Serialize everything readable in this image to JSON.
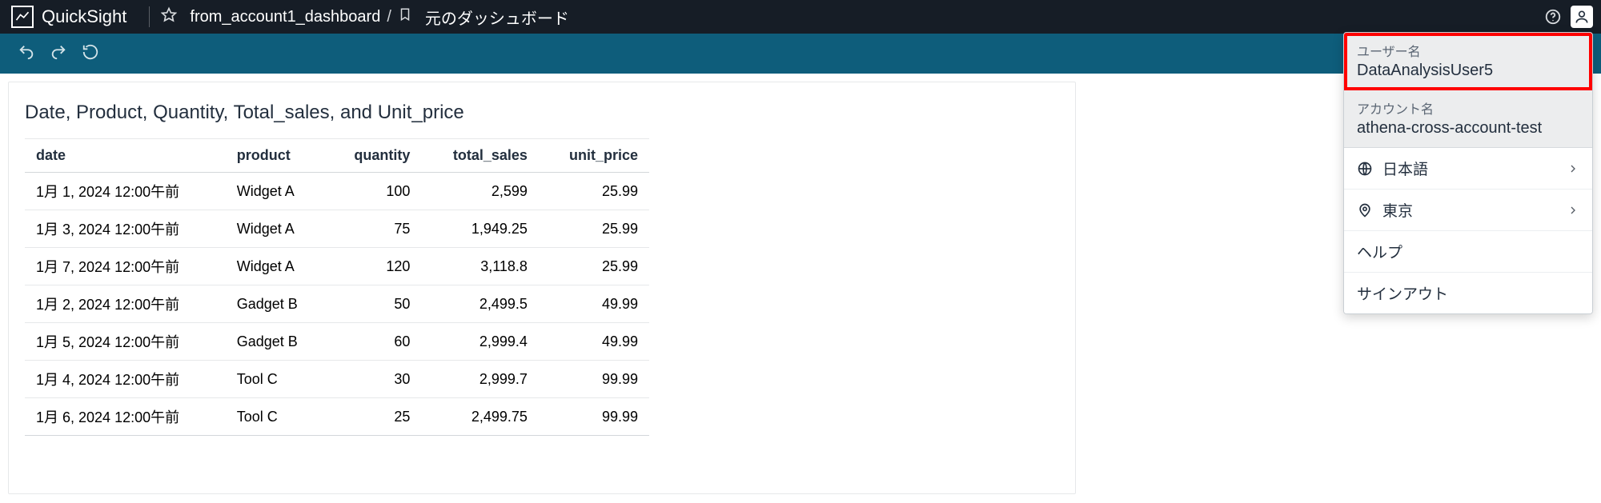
{
  "header": {
    "brand": "QuickSight",
    "breadcrumb": {
      "item1": "from_account1_dashboard",
      "item2": "元のダッシュボード"
    }
  },
  "card": {
    "title": "Date, Product, Quantity, Total_sales, and Unit_price"
  },
  "chart_data": {
    "type": "table",
    "columns": [
      "date",
      "product",
      "quantity",
      "total_sales",
      "unit_price"
    ],
    "rows": [
      {
        "date": "1月 1, 2024 12:00午前",
        "product": "Widget A",
        "quantity": "100",
        "total_sales": "2,599",
        "unit_price": "25.99"
      },
      {
        "date": "1月 3, 2024 12:00午前",
        "product": "Widget A",
        "quantity": "75",
        "total_sales": "1,949.25",
        "unit_price": "25.99"
      },
      {
        "date": "1月 7, 2024 12:00午前",
        "product": "Widget A",
        "quantity": "120",
        "total_sales": "3,118.8",
        "unit_price": "25.99"
      },
      {
        "date": "1月 2, 2024 12:00午前",
        "product": "Gadget B",
        "quantity": "50",
        "total_sales": "2,499.5",
        "unit_price": "49.99"
      },
      {
        "date": "1月 5, 2024 12:00午前",
        "product": "Gadget B",
        "quantity": "60",
        "total_sales": "2,999.4",
        "unit_price": "49.99"
      },
      {
        "date": "1月 4, 2024 12:00午前",
        "product": "Tool C",
        "quantity": "30",
        "total_sales": "2,999.7",
        "unit_price": "99.99"
      },
      {
        "date": "1月 6, 2024 12:00午前",
        "product": "Tool C",
        "quantity": "25",
        "total_sales": "2,499.75",
        "unit_price": "99.99"
      }
    ]
  },
  "user_menu": {
    "username_label": "ユーザー名",
    "username_value": "DataAnalysisUser5",
    "account_label": "アカウント名",
    "account_value": "athena-cross-account-test",
    "language": "日本語",
    "region": "東京",
    "help": "ヘルプ",
    "signout": "サインアウト"
  }
}
